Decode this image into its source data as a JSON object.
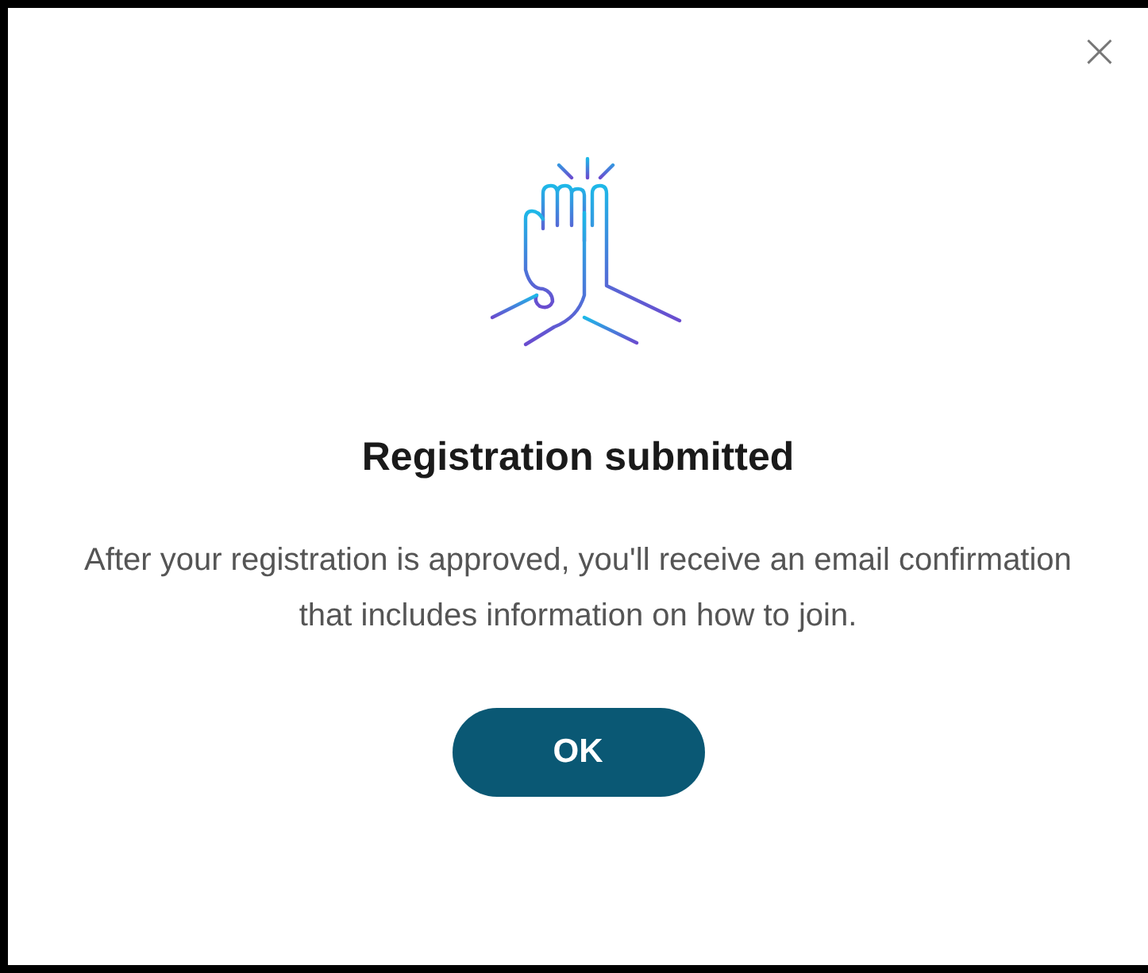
{
  "dialog": {
    "close": "×",
    "title": "Registration submitted",
    "message": "After your registration is approved, you'll receive an email confirmation that includes information on how to join.",
    "buttons": [
      "OK"
    ]
  }
}
